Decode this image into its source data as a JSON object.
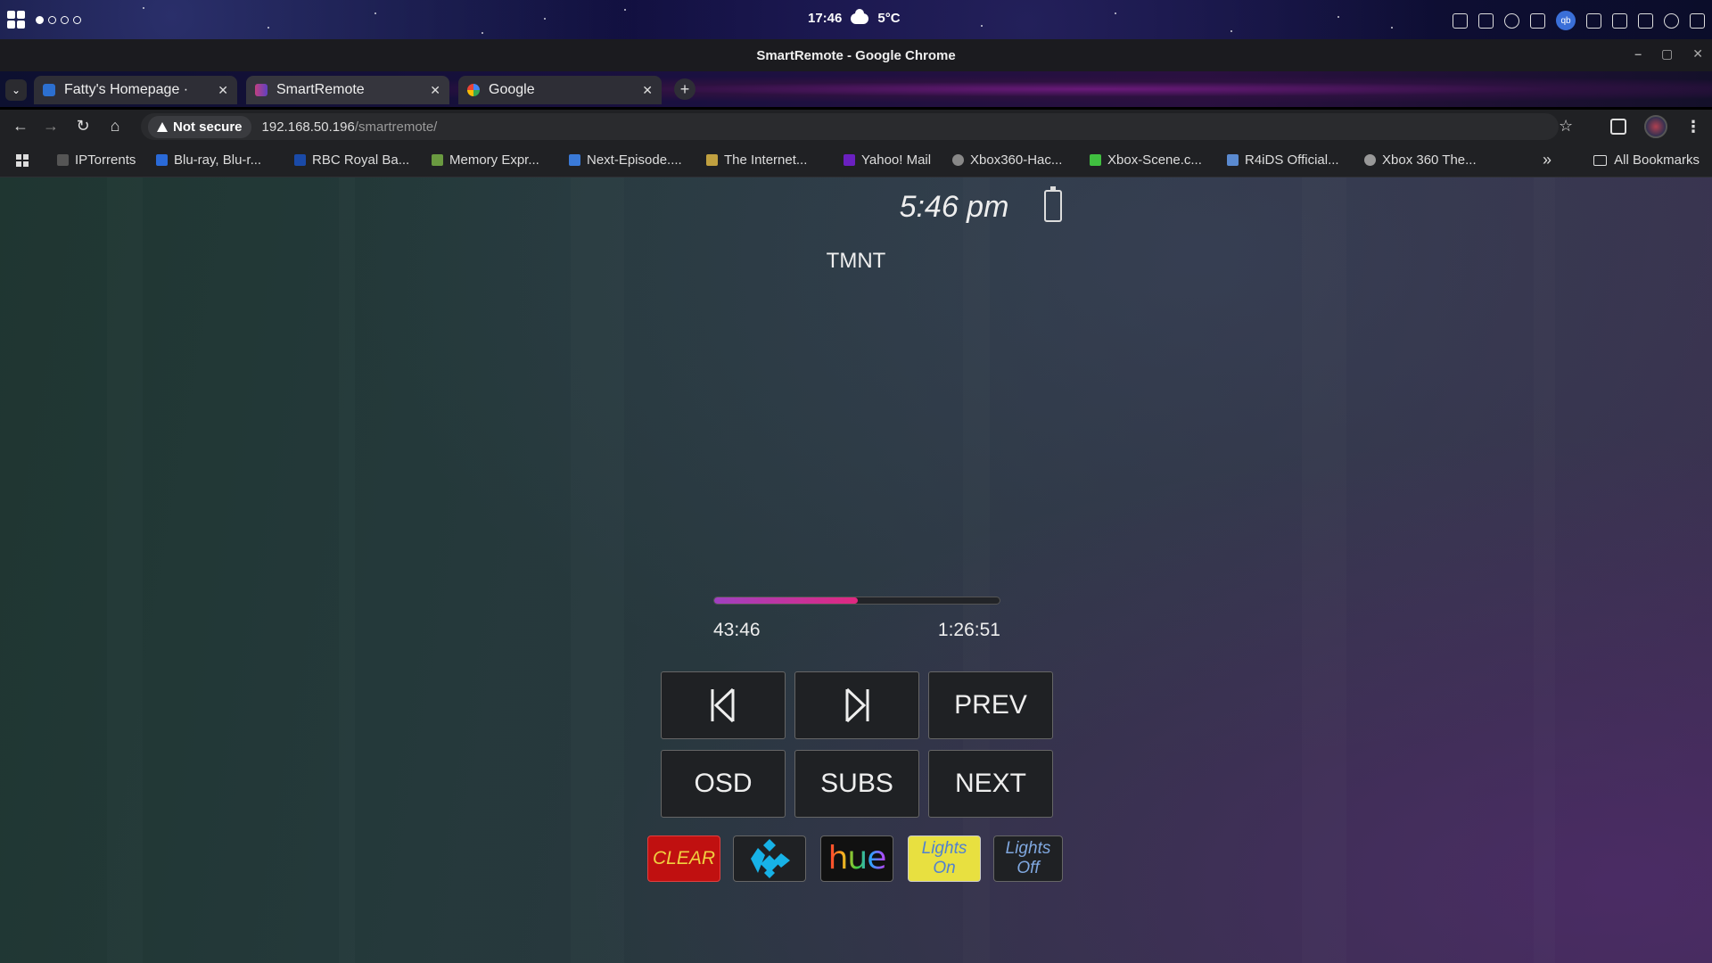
{
  "system_bar": {
    "time": "17:46",
    "weather": "5°C"
  },
  "window": {
    "title": "SmartRemote - Google Chrome"
  },
  "tabs": [
    {
      "title": "Fatty's Homepage ·",
      "active": false
    },
    {
      "title": "SmartRemote",
      "active": true
    },
    {
      "title": "Google",
      "active": false
    }
  ],
  "address_bar": {
    "security_label": "Not secure",
    "url_host": "192.168.50.196",
    "url_path": "/smartremote/"
  },
  "bookmarks": {
    "items": [
      "IPTorrents",
      "Blu-ray, Blu-r...",
      "RBC Royal Ba...",
      "Memory Expr...",
      "Next-Episode....",
      "The Internet...",
      "Yahoo! Mail",
      "Xbox360-Hac...",
      "Xbox-Scene.c...",
      "R4iDS Official...",
      "Xbox 360 The..."
    ],
    "all_label": "All Bookmarks"
  },
  "remote": {
    "clock": "5:46 pm",
    "now_playing": "TMNT",
    "elapsed": "43:46",
    "total": "1:26:51",
    "progress_fraction": 0.504,
    "buttons": {
      "prev": "PREV",
      "osd": "OSD",
      "subs": "SUBS",
      "next": "NEXT",
      "clear": "CLEAR",
      "hue": "hue",
      "lights_on_line1": "Lights",
      "lights_on_line2": "On",
      "lights_off_line1": "Lights",
      "lights_off_line2": "Off"
    },
    "colors": {
      "progress_start": "#a040c0",
      "progress_end": "#e02880",
      "clear_bg": "#c01010",
      "lights_on_bg": "#e8e040",
      "kodi_blue": "#17b2e7"
    }
  }
}
